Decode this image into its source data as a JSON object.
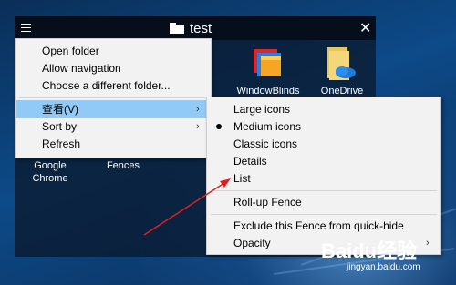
{
  "fence": {
    "title": "test",
    "icons": [
      {
        "label": "WindowBlinds"
      },
      {
        "label": "OneDrive"
      },
      {
        "label": "Google\nChrome"
      },
      {
        "label": "Fences"
      }
    ]
  },
  "context_menu": {
    "items": [
      {
        "label": "Open folder"
      },
      {
        "label": "Allow navigation"
      },
      {
        "label": "Choose a different folder..."
      },
      {
        "label": "查看(V)",
        "has_submenu": true,
        "highlighted": true
      },
      {
        "label": "Sort by",
        "has_submenu": true
      },
      {
        "label": "Refresh"
      }
    ]
  },
  "view_submenu": {
    "items": [
      {
        "label": "Large icons"
      },
      {
        "label": "Medium icons",
        "selected": true
      },
      {
        "label": "Classic icons"
      },
      {
        "label": "Details"
      },
      {
        "label": "List"
      },
      {
        "label": "Roll-up Fence"
      },
      {
        "label": "Exclude this Fence from quick-hide"
      },
      {
        "label": "Opacity",
        "has_submenu": true
      }
    ]
  },
  "watermark": {
    "brand": "Baidu经验",
    "url": "jingyan.baidu.com"
  },
  "colors": {
    "highlight": "#91c9f7",
    "annotation_arrow": "#e02020",
    "menu_bg": "#f2f2f2"
  }
}
